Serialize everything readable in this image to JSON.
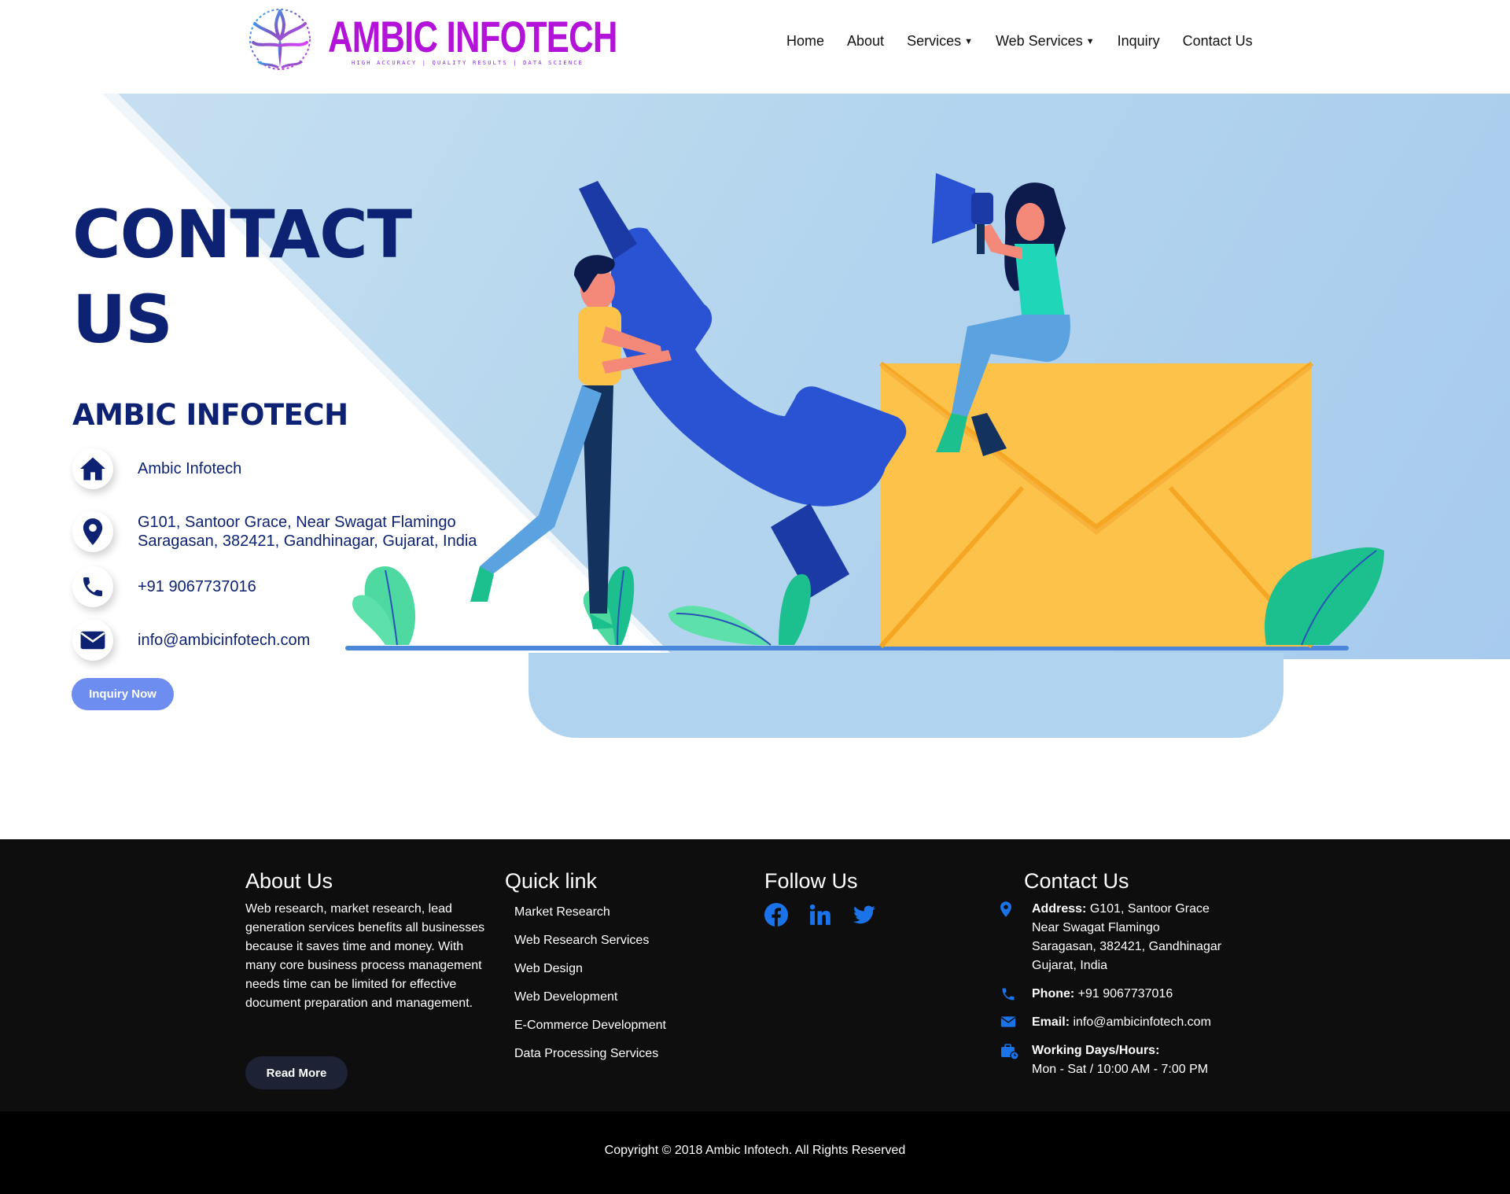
{
  "header": {
    "logo_text": "AMBIC INFOTECH",
    "logo_tagline": "HIGH ACCURACY | QUALITY RESULTS | DATA SCIENCE",
    "nav": [
      {
        "label": "Home"
      },
      {
        "label": "About"
      },
      {
        "label": "Services"
      },
      {
        "label": "Web Services"
      },
      {
        "label": "Inquiry"
      },
      {
        "label": "Contact Us"
      }
    ]
  },
  "hero": {
    "title_line1": "CONTACT",
    "title_line2": "US",
    "company": "AMBIC INFOTECH",
    "info": {
      "name": "Ambic Infotech",
      "address_line1": "G101, Santoor Grace, Near Swagat Flamingo",
      "address_line2": "Saragasan, 382421, Gandhinagar, Gujarat, India",
      "phone": "+91 9067737016",
      "email": "info@ambicinfotech.com"
    },
    "inquiry_button": "Inquiry Now"
  },
  "footer": {
    "about": {
      "heading": "About Us",
      "text": "Web research, market research, lead generation services benefits all businesses because it saves time and money. With many core business process management needs time can be limited for effective document preparation and management.",
      "button": "Read More"
    },
    "quicklinks": {
      "heading": "Quick link",
      "items": [
        "Market Research",
        "Web Research Services",
        "Web Design",
        "Web Development",
        "E-Commerce Development",
        "Data Processing Services"
      ]
    },
    "follow": {
      "heading": "Follow Us",
      "icons": [
        "facebook-icon",
        "linkedin-icon",
        "twitter-icon"
      ]
    },
    "contact": {
      "heading": "Contact Us",
      "address_label": "Address:",
      "address_1": "G101, Santoor Grace",
      "address_2": "Near Swagat Flamingo",
      "address_3": "Saragasan, 382421, Gandhinagar",
      "address_4": "Gujarat, India",
      "phone_label": "Phone:",
      "phone": "+91 9067737016",
      "email_label": "Email:",
      "email": "info@ambicinfotech.com",
      "hours_label": "Working Days/Hours:",
      "hours": "Mon - Sat / 10:00 AM - 7:00 PM"
    },
    "copyright": "Copyright © 2018 Ambic Infotech. All Rights Reserved"
  },
  "colors": {
    "brand_navy": "#0d2272",
    "accent_blue": "#1a73e8",
    "button_blue": "#6d8df0",
    "logo_purple": "#b312d8",
    "footer_bg": "#0e0e0e"
  }
}
